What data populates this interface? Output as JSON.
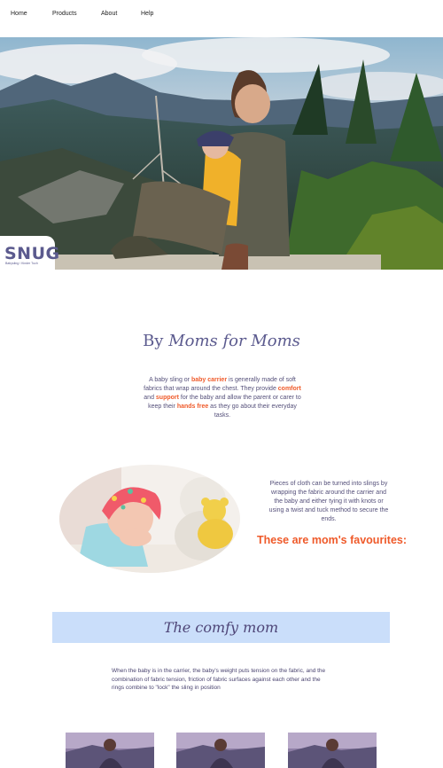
{
  "nav": {
    "items": [
      {
        "label": "Home"
      },
      {
        "label": "Products"
      },
      {
        "label": "About"
      },
      {
        "label": "Help"
      }
    ]
  },
  "logo": {
    "text": "SNUG",
    "tagline": "Babysling / Kinder Tuch"
  },
  "section1": {
    "heading_by": "By ",
    "heading_rest": "Moms for Moms",
    "intro": {
      "p1": "A baby sling or ",
      "h1": "baby carrier",
      "p2": " is generally made of soft fabrics that wrap around the chest. They provide ",
      "h2": "comfort",
      "p3": " and ",
      "h3": "support",
      "p4": " for the baby and allow the parent or carer to keep their ",
      "h4": "hands free",
      "p5": " as they go about their everyday tasks."
    }
  },
  "section2": {
    "text": "Pieces of cloth can be turned into slings by wrapping the fabric around the carrier and the baby and either tying it with knots or using a twist and tuck method to secure the ends.",
    "favourites": "These are mom's favourites:"
  },
  "banner": {
    "title": "The comfy mom"
  },
  "section3": {
    "text": "When the baby is in the carrier, the baby's weight puts tension on the fabric, and the combination of fabric tension, friction of fabric surfaces against each other and the rings combine to \"lock\" the sling in position"
  },
  "colors": {
    "accent": "#ef5a2a",
    "brand": "#5b5a8e",
    "banner_bg": "#cadefa"
  }
}
